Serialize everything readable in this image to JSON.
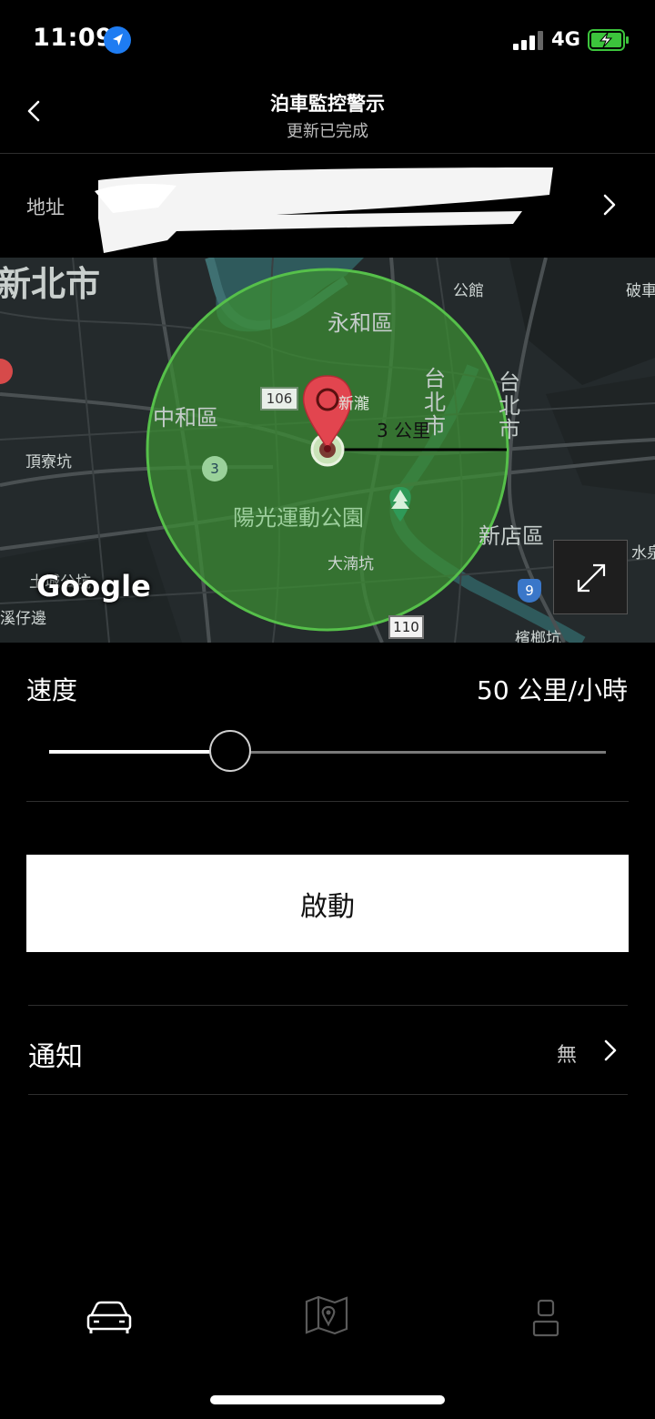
{
  "status_bar": {
    "time": "11:09",
    "network": "4G",
    "icons": [
      "location-arrow-icon",
      "signal-bars-icon",
      "battery-charging-icon"
    ]
  },
  "header": {
    "title": "泊車監控警示",
    "subtitle": "更新已完成"
  },
  "address": {
    "label": "地址"
  },
  "map": {
    "labels": {
      "new_taipei": "新北市",
      "yonghe": "永和區",
      "zhonghe": "中和區",
      "gongguan": "公館",
      "po": "破車",
      "dingliao": "頂寮坑",
      "sunshine_park": "陽光運動公園",
      "xindian": "新店區",
      "dadikeng": "大湳坑",
      "xiziping": "溪仔邊",
      "binlangkeng": "檳榔坑",
      "tupo": "土城公坑",
      "taipei_vert": "台北市",
      "taipei_vert2": "台北市",
      "shuiquan": "水泉",
      "guanglang": "新瀧"
    },
    "road_badges": {
      "r106": "106",
      "r110": "110",
      "r9": "9",
      "r3": "3"
    },
    "radius_label": "3 公里",
    "google_logo": "Google",
    "geofence_color": "#3a9a3a",
    "pin_color": "#e2454f"
  },
  "speed": {
    "label": "速度",
    "value": "50 公里/小時",
    "slider_fraction": 0.325
  },
  "start_button": {
    "label": "啟動"
  },
  "notification": {
    "label": "通知",
    "value": "無"
  },
  "tab_bar": {
    "tabs": [
      {
        "icon": "car-icon",
        "active": true
      },
      {
        "icon": "map-pin-icon",
        "active": false
      },
      {
        "icon": "profile-icon",
        "active": false
      }
    ]
  }
}
